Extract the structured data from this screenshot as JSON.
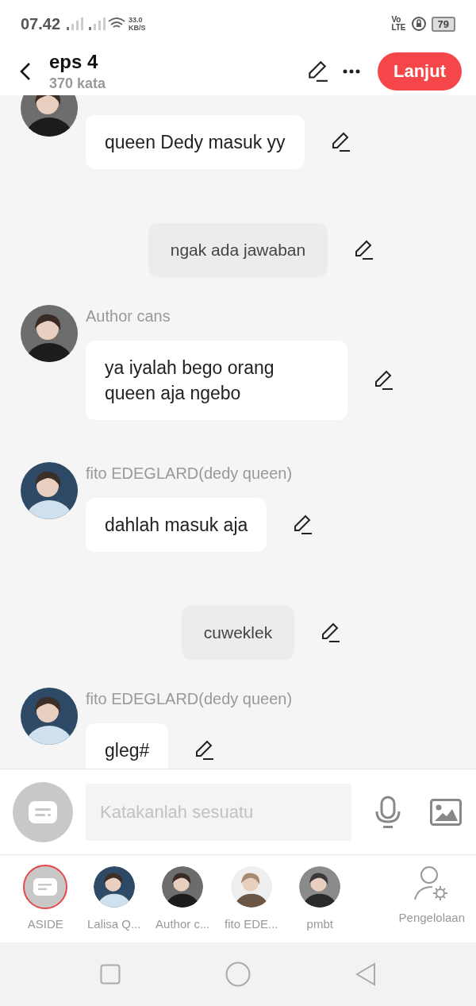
{
  "status_bar": {
    "time": "07.42",
    "speed_value": "33.0",
    "speed_unit": "KB/S",
    "volte_top": "Vo",
    "volte_bottom": "LTE",
    "battery": "79"
  },
  "header": {
    "title": "eps 4",
    "subtitle": "370 kata",
    "action": "Lanjut"
  },
  "messages": [
    {
      "kind": "character",
      "text": "queen Dedy masuk yy"
    },
    {
      "kind": "aside",
      "text": "ngak ada jawaban"
    },
    {
      "kind": "character",
      "sender": "Author cans",
      "text": "ya iyalah bego orang queen aja ngebo"
    },
    {
      "kind": "character",
      "sender": "fito EDEGLARD(dedy queen)",
      "text": "dahlah masuk aja"
    },
    {
      "kind": "aside",
      "text": "cuweklek"
    },
    {
      "kind": "character",
      "sender": "fito EDEGLARD(dedy queen)",
      "text": "gleg#"
    }
  ],
  "input": {
    "placeholder": "Katakanlah sesuatu"
  },
  "cast": [
    {
      "kind": "aside",
      "label": "ASIDE",
      "selected": true
    },
    {
      "kind": "avatar",
      "label": "Lalisa Q...",
      "selected": false
    },
    {
      "kind": "avatar",
      "label": "Author c...",
      "selected": false
    },
    {
      "kind": "avatar",
      "label": "fito EDE...",
      "selected": false
    },
    {
      "kind": "avatar",
      "label": "pmbt",
      "selected": false
    }
  ],
  "manage": {
    "label": "Pengelolaan"
  }
}
